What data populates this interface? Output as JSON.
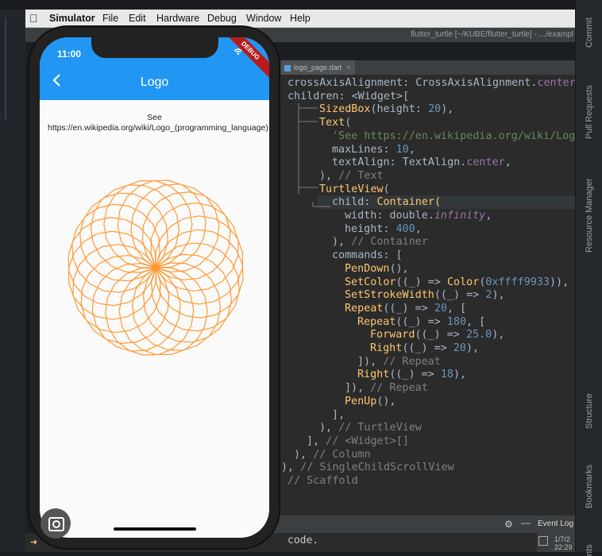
{
  "menubar": {
    "app": "Simulator",
    "items": [
      "File",
      "Edit",
      "Hardware",
      "Debug",
      "Window",
      "Help"
    ]
  },
  "ide": {
    "window_title": "flutter_turtle [~/KUBE/flutter_turtle] - .../exampl",
    "tab_label": "logo_page.dart",
    "tab_close": "×",
    "bottom": {
      "event_log": "Event Log"
    },
    "terminal_text": "code.",
    "log_time": [
      "1/7/2",
      "22:29"
    ],
    "right_tools": [
      "Commit",
      "Pull Requests",
      "Resource Manager",
      "Structure",
      "Bookmarks",
      "nts"
    ]
  },
  "code_lines": [
    [
      [
        "t",
        "crossAxisAlignment: CrossAxisAlignment."
      ],
      [
        "p",
        "center"
      ]
    ],
    [
      [
        "t",
        "children: <Widget>["
      ]
    ],
    [
      [
        "f",
        "SizedBox"
      ],
      [
        "t",
        "(height: "
      ],
      [
        "n",
        "20"
      ],
      [
        "t",
        "),"
      ]
    ],
    [
      [
        "f",
        "Text"
      ],
      [
        "t",
        "("
      ]
    ],
    [
      [
        "s",
        "'See https://en.wikipedia.org/wiki/Logo"
      ]
    ],
    [
      [
        "t",
        "maxLines: "
      ],
      [
        "n",
        "10"
      ],
      [
        "t",
        ","
      ]
    ],
    [
      [
        "t",
        "textAlign: TextAlign."
      ],
      [
        "p",
        "center"
      ],
      [
        "t",
        ","
      ]
    ],
    [
      [
        "t",
        "), "
      ],
      [
        "c",
        "// Text"
      ]
    ],
    [
      [
        "f",
        "TurtleView"
      ],
      [
        "t",
        "("
      ]
    ],
    [
      [
        "t",
        "child: "
      ],
      [
        "f",
        "Container("
      ]
    ],
    [
      [
        "t",
        "width: double."
      ],
      [
        "i",
        "infinity"
      ],
      [
        "t",
        ","
      ]
    ],
    [
      [
        "t",
        "height: "
      ],
      [
        "n",
        "400"
      ],
      [
        "t",
        ","
      ]
    ],
    [
      [
        "t",
        "), "
      ],
      [
        "c",
        "// Container"
      ]
    ],
    [
      [
        "t",
        "commands: ["
      ]
    ],
    [
      [
        "f",
        "PenDown"
      ],
      [
        "t",
        "(),"
      ]
    ],
    [
      [
        "f",
        "SetColor"
      ],
      [
        "t",
        "((_) => "
      ],
      [
        "f",
        "Color"
      ],
      [
        "t",
        "("
      ],
      [
        "n",
        "0xffff9933"
      ],
      [
        "t",
        ")),"
      ]
    ],
    [
      [
        "f",
        "SetStrokeWidth"
      ],
      [
        "t",
        "((_) => "
      ],
      [
        "n",
        "2"
      ],
      [
        "t",
        "),"
      ]
    ],
    [
      [
        "f",
        "Repeat"
      ],
      [
        "t",
        "((_) => "
      ],
      [
        "n",
        "20"
      ],
      [
        "t",
        ", ["
      ]
    ],
    [
      [
        "f",
        "Repeat"
      ],
      [
        "t",
        "((_) => "
      ],
      [
        "n",
        "180"
      ],
      [
        "t",
        ", ["
      ]
    ],
    [
      [
        "f",
        "Forward"
      ],
      [
        "t",
        "((_) => "
      ],
      [
        "n",
        "25.0"
      ],
      [
        "t",
        "),"
      ]
    ],
    [
      [
        "f",
        "Right"
      ],
      [
        "t",
        "((_) => "
      ],
      [
        "n",
        "20"
      ],
      [
        "t",
        "),"
      ]
    ],
    [
      [
        "t",
        "]), "
      ],
      [
        "c",
        "// Repeat"
      ]
    ],
    [
      [
        "f",
        "Right"
      ],
      [
        "t",
        "((_) => "
      ],
      [
        "n",
        "18"
      ],
      [
        "t",
        "),"
      ]
    ],
    [
      [
        "t",
        "]), "
      ],
      [
        "c",
        "// Repeat"
      ]
    ],
    [
      [
        "f",
        "PenUp"
      ],
      [
        "t",
        "(),"
      ]
    ],
    [
      [
        "t",
        "],"
      ]
    ],
    [
      [
        "t",
        "), "
      ],
      [
        "c",
        "// TurtleView"
      ]
    ],
    [
      [
        "t",
        "], "
      ],
      [
        "c",
        "// <Widget>[]"
      ]
    ],
    [
      [
        "t",
        "), "
      ],
      [
        "c",
        "// Column"
      ]
    ],
    [
      [
        "t",
        "), "
      ],
      [
        "c",
        "// SingleChildScrollView"
      ]
    ],
    [
      [
        "c",
        "// Scaffold"
      ]
    ]
  ],
  "phone": {
    "time": "11:00",
    "debug_banner": "DEBUG",
    "back_glyph": "‹",
    "title": "Logo",
    "description": "See https://en.wikipedia.org/wiki/Logo_(programming_language)",
    "turtle": {
      "color": "#ff9933",
      "stroke_width": 2,
      "outer_repeat": 20,
      "inner_repeat": 180,
      "forward": 25.0,
      "inner_turn": 20,
      "outer_turn": 18
    }
  },
  "colors": {
    "appbar": "#2196f3",
    "editor_bg": "#2b2b2b",
    "turtle": "#ff9933"
  }
}
